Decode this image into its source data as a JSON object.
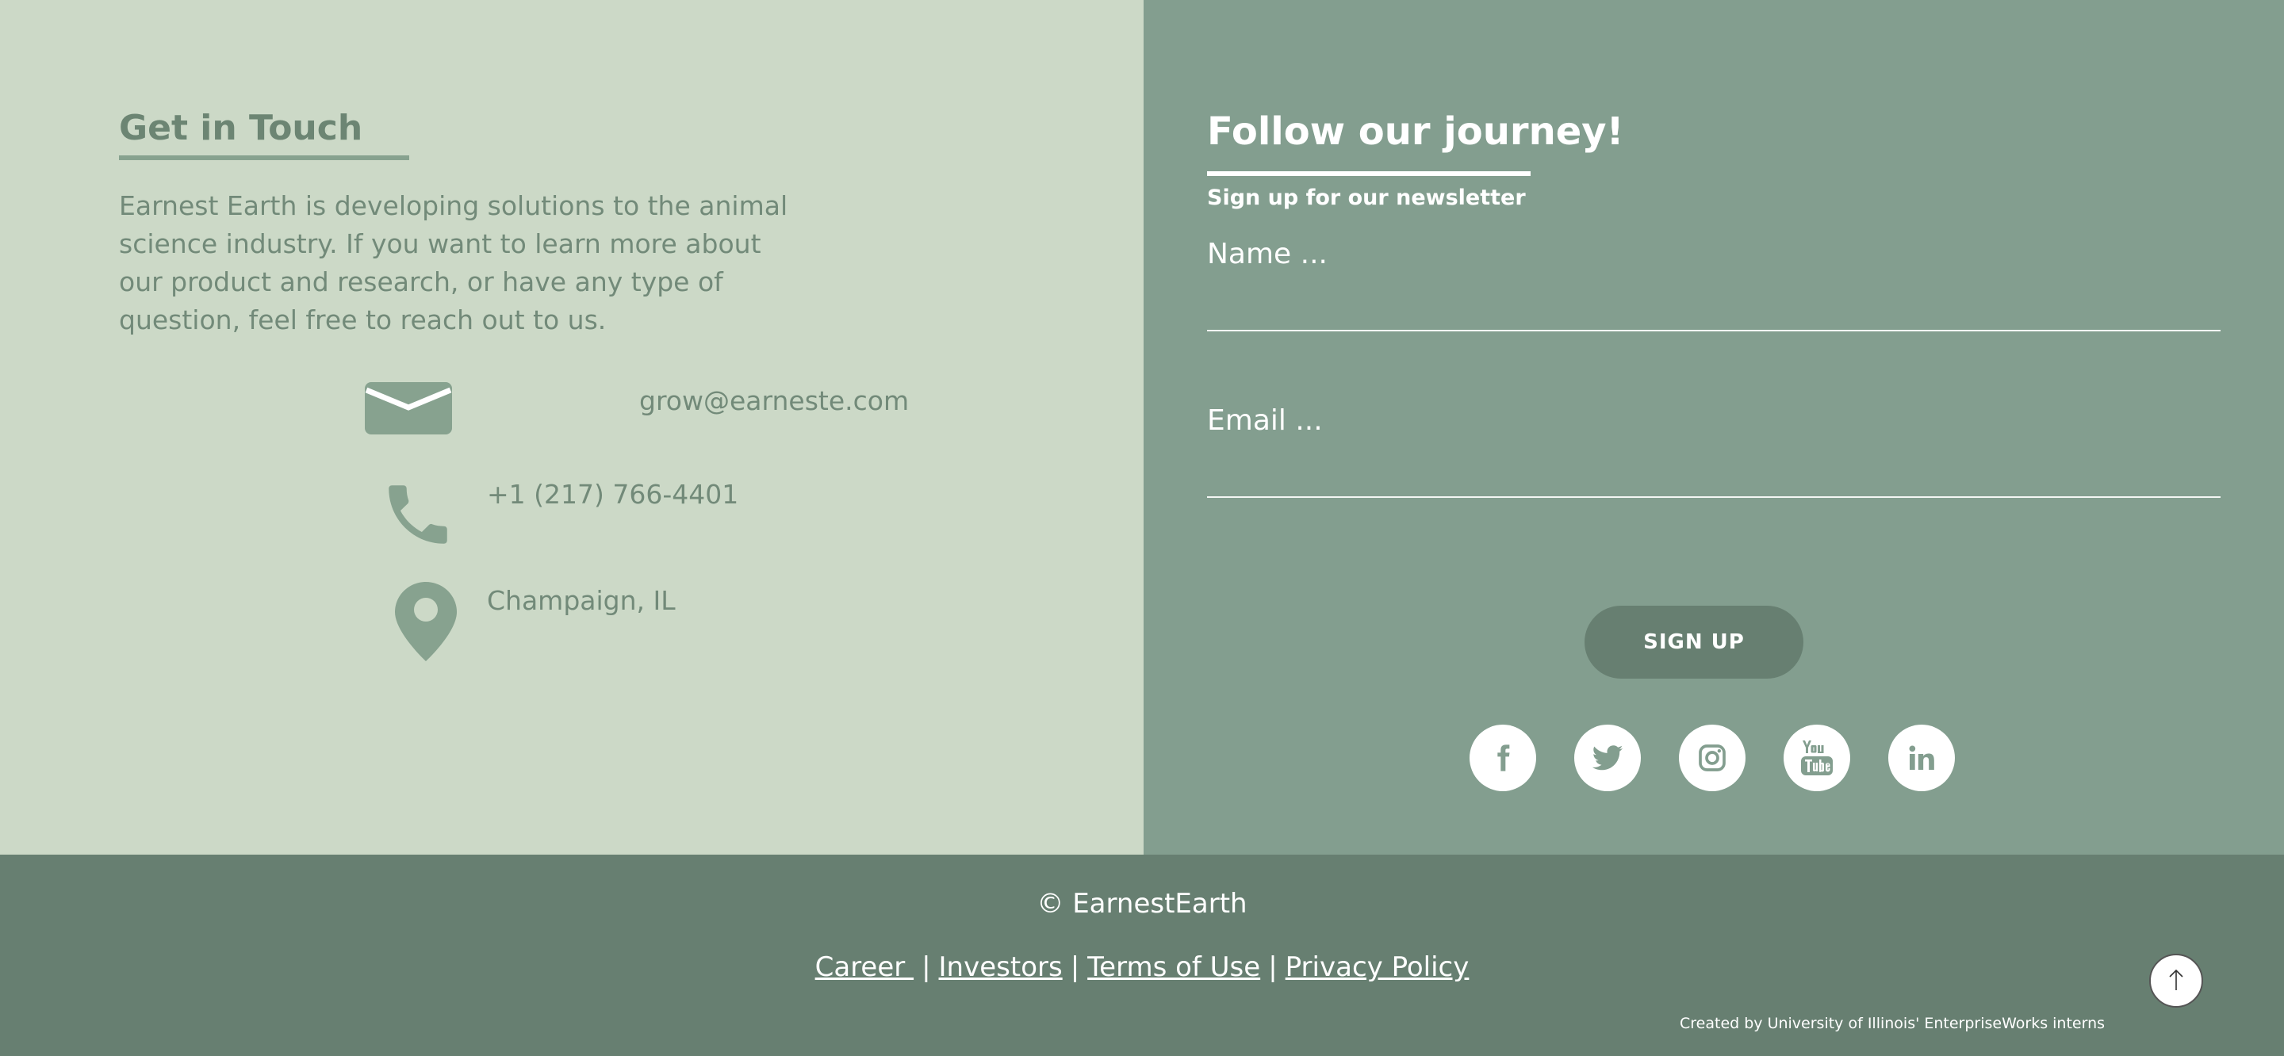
{
  "contact": {
    "title": "Get in Touch",
    "description": "Earnest Earth is developing solutions to the animal science industry. If you want to learn more about our product and research, or have any type of question, feel free to reach out to us.",
    "email": "grow@earneste.com",
    "phone": "+1 (217) 766-4401",
    "location": "Champaign, IL",
    "icons": [
      "envelope-icon",
      "phone-icon",
      "map-pin-icon"
    ]
  },
  "newsletter": {
    "title": "Follow our journey!",
    "subtitle": "Sign up for our newsletter",
    "name_placeholder": "Name ...",
    "email_placeholder": "Email ...",
    "signup_label": "SIGN UP"
  },
  "social": [
    "facebook-icon",
    "twitter-icon",
    "instagram-icon",
    "youtube-icon",
    "linkedin-icon"
  ],
  "footer": {
    "copyright": "© EarnestEarth",
    "links": [
      "Career ",
      "Investors",
      "Terms of Use",
      "Privacy Policy"
    ],
    "separator": "|",
    "credit": "Created by University of Illinois' EnterpriseWorks interns"
  },
  "colors": {
    "left_bg": "#ccd9c7",
    "right_bg": "#839e8f",
    "footer_bg": "#677f71",
    "accent_text": "#6c8573"
  }
}
